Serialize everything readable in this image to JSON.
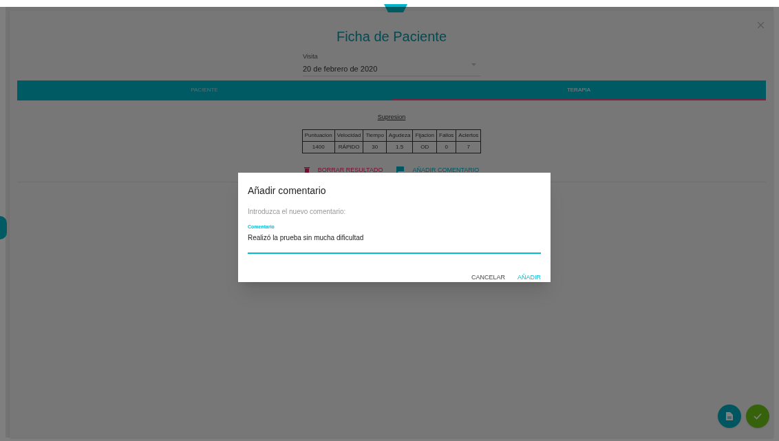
{
  "page": {
    "title": "Ficha de Paciente"
  },
  "visit_select": {
    "label": "Visita",
    "value": "20 de febrero de 2020"
  },
  "tabs": [
    {
      "label": "PACIENTE",
      "selected": false
    },
    {
      "label": "TERAPIA",
      "selected": true
    }
  ],
  "result": {
    "title": "Supresion",
    "columns": [
      "Puntuacion",
      "Velocidad",
      "Tiempo",
      "Agudeza",
      "Fijacion",
      "Fallos",
      "Aciertos"
    ],
    "rows": [
      [
        "1400",
        "RÁPIDO",
        "30",
        "1.5",
        "OD",
        "0",
        "7"
      ]
    ]
  },
  "actions": [
    {
      "kind": "delete",
      "label": "BORRAR RESULTADO"
    },
    {
      "kind": "comment",
      "label": "AÑADIR COMENTARIO"
    }
  ],
  "dialog": {
    "title": "Añadir comentario",
    "text": "Introduzca el nuevo comentario:",
    "field_label": "Comentario",
    "field_value": "Realizó la prueba sin mucha dificultad",
    "buttons": [
      {
        "label": "CANCELAR",
        "primary": false
      },
      {
        "label": "AÑADIR",
        "primary": true
      }
    ]
  }
}
